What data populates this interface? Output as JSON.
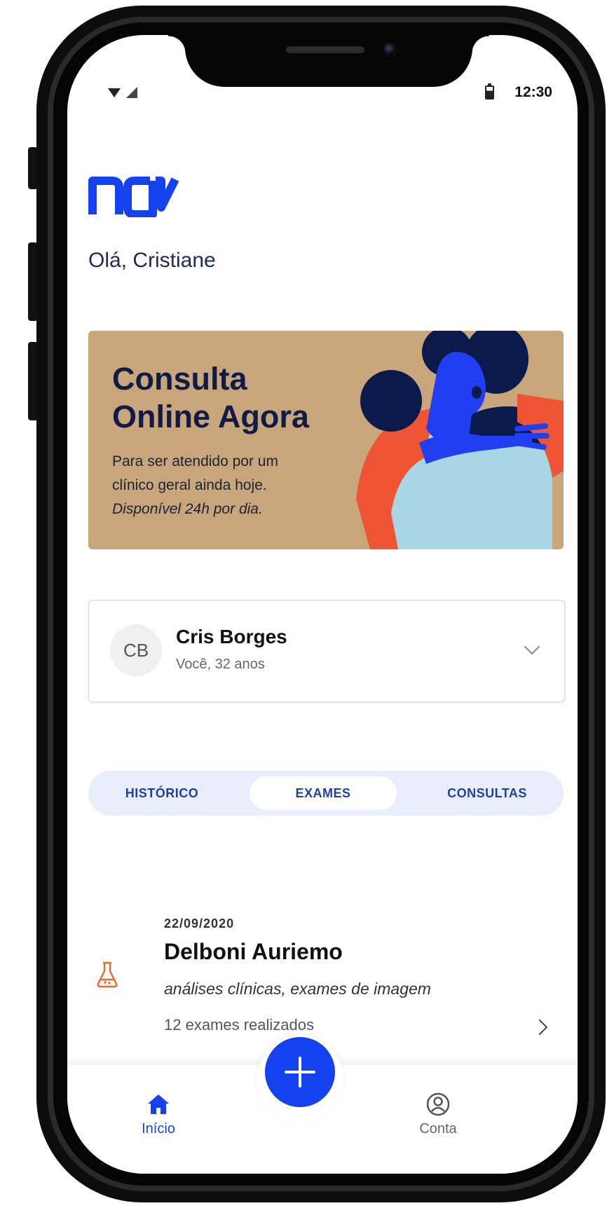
{
  "status_bar": {
    "time": "12:30"
  },
  "logo_text": "nav",
  "greeting": "Olá, Cristiane",
  "banner": {
    "title": "Consulta\nOnline Agora",
    "line1": "Para ser atendido por um",
    "line2": "clínico geral ainda hoje.",
    "line3": "Disponível 24h por dia."
  },
  "profile": {
    "initials": "CB",
    "name": "Cris Borges",
    "subtitle": "Você, 32 anos"
  },
  "tabs": [
    {
      "label": "HISTÓRICO",
      "active": false
    },
    {
      "label": "EXAMES",
      "active": true
    },
    {
      "label": "CONSULTAS",
      "active": false
    }
  ],
  "exam": {
    "date": "22/09/2020",
    "title": "Delboni Auriemo",
    "categories": "análises clínicas, exames de imagem",
    "count": "12 exames realizados"
  },
  "bottom_nav": {
    "home_label": "Início",
    "account_label": "Conta"
  },
  "colors": {
    "primary": "#1542f0",
    "banner_bg": "#c9a57c",
    "navy_text": "#0e1c46",
    "tab_bg": "#e8eefc",
    "exam_icon": "#f06a2a"
  }
}
